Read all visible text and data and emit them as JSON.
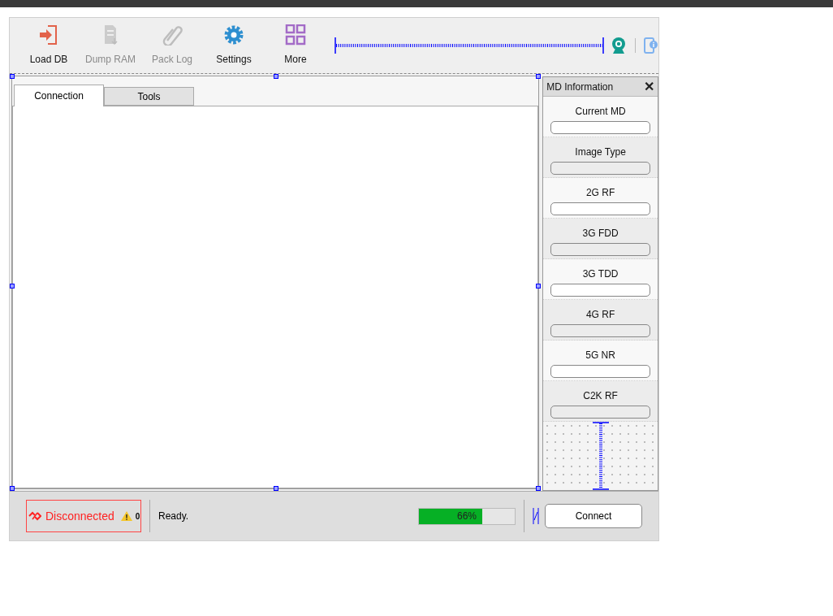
{
  "toolbar": {
    "buttons": [
      {
        "label": "Load DB",
        "kind": "load",
        "disabled": false
      },
      {
        "label": "Dump RAM",
        "kind": "dump",
        "disabled": true
      },
      {
        "label": "Pack Log",
        "kind": "clip",
        "disabled": true
      },
      {
        "label": "Settings",
        "kind": "gear",
        "disabled": false
      },
      {
        "label": "More",
        "kind": "grid",
        "disabled": false
      }
    ]
  },
  "tabs": [
    {
      "label": "Connection",
      "selected": true
    },
    {
      "label": "Tools",
      "selected": false
    }
  ],
  "md_panel": {
    "title": "MD Information",
    "close": "✕",
    "fields": [
      {
        "label": "Current MD"
      },
      {
        "label": "Image Type"
      },
      {
        "label": "2G RF"
      },
      {
        "label": "3G FDD"
      },
      {
        "label": "3G TDD"
      },
      {
        "label": "4G RF"
      },
      {
        "label": "5G NR"
      },
      {
        "label": "C2K RF"
      }
    ]
  },
  "status_bar": {
    "connection": "Disconnected",
    "warning_count": "0",
    "message": "Ready.",
    "progress": {
      "level": 0.66,
      "reading": "66%"
    },
    "connect_button": "Connect"
  }
}
